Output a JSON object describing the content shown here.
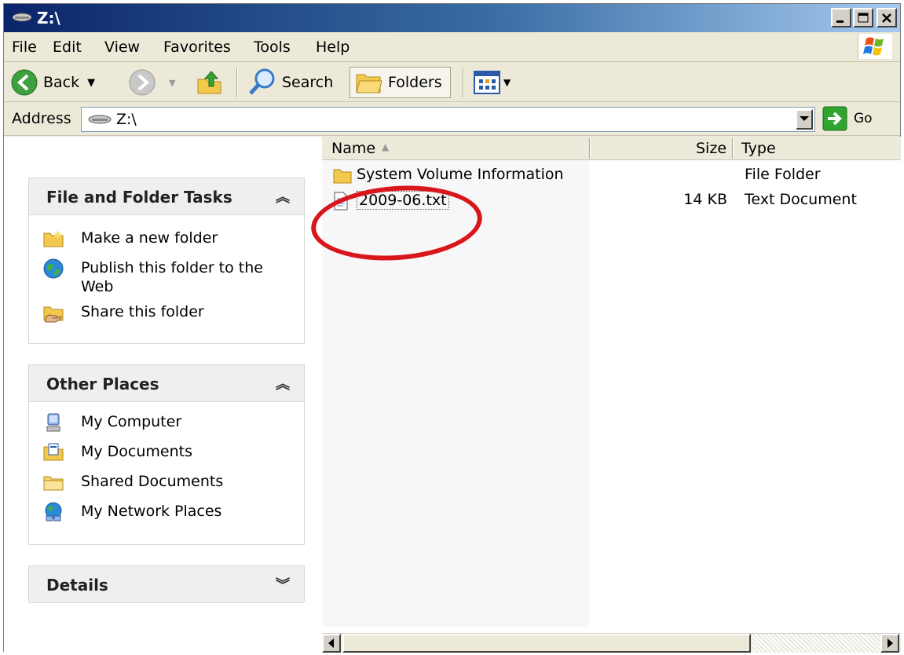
{
  "window": {
    "title": "Z:\\"
  },
  "menubar": {
    "items": [
      {
        "label": "File"
      },
      {
        "label": "Edit"
      },
      {
        "label": "View"
      },
      {
        "label": "Favorites"
      },
      {
        "label": "Tools"
      },
      {
        "label": "Help"
      }
    ]
  },
  "toolbar": {
    "back_label": "Back",
    "search_label": "Search",
    "folders_label": "Folders"
  },
  "address": {
    "label": "Address",
    "value": "Z:\\",
    "go_label": "Go"
  },
  "tasks_panel": {
    "title": "File and Folder Tasks",
    "items": [
      {
        "label": "Make a new folder",
        "icon": "new-folder-icon"
      },
      {
        "label": "Publish this folder to the Web",
        "icon": "publish-web-icon"
      },
      {
        "label": "Share this folder",
        "icon": "share-folder-icon"
      }
    ]
  },
  "places_panel": {
    "title": "Other Places",
    "items": [
      {
        "label": "My Computer",
        "icon": "my-computer-icon"
      },
      {
        "label": "My Documents",
        "icon": "my-documents-icon"
      },
      {
        "label": "Shared Documents",
        "icon": "shared-documents-icon"
      },
      {
        "label": "My Network Places",
        "icon": "network-places-icon"
      }
    ]
  },
  "details_panel": {
    "title": "Details"
  },
  "file_list": {
    "columns": [
      "Name",
      "Size",
      "Type"
    ],
    "rows": [
      {
        "name": "System Volume Information",
        "size": "",
        "type": "File Folder",
        "icon": "folder-icon"
      },
      {
        "name": "2009-06.txt",
        "size": "14 KB",
        "type": "Text Document",
        "icon": "text-file-icon",
        "highlighted": true
      }
    ]
  },
  "colors": {
    "title_bar": "#0a246a",
    "annotation_ring": "#d8161b",
    "go_arrow": "#2fa52f"
  }
}
